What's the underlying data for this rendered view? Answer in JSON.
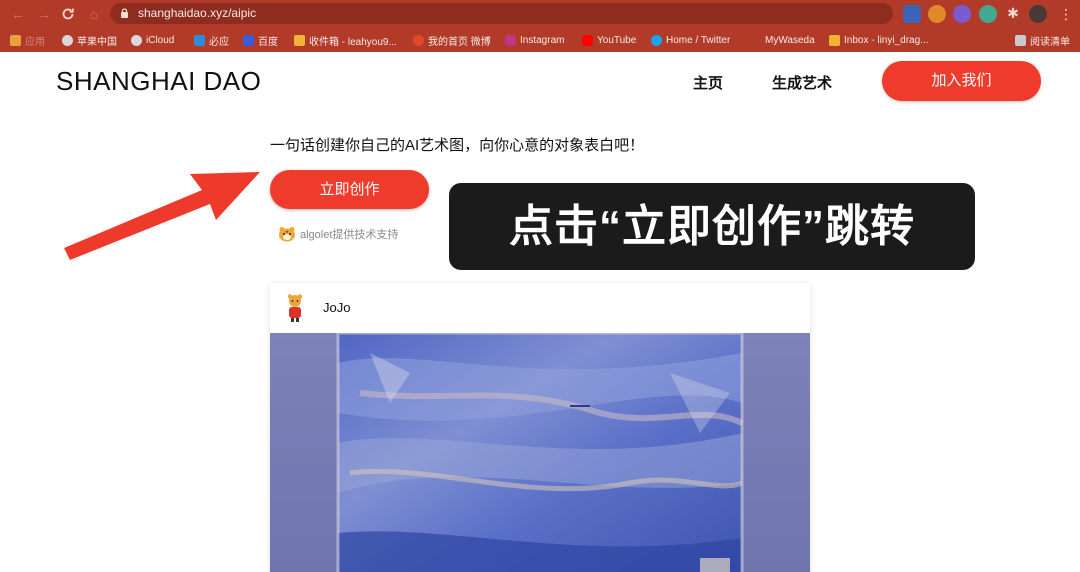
{
  "browser": {
    "url": "shanghaidao.xyz/aipic",
    "bookmarks": [
      {
        "label": "应用",
        "color": "#e9a23b"
      },
      {
        "label": "苹果中国",
        "color": "#d9d9d9"
      },
      {
        "label": "iCloud",
        "color": "#d9d9d9"
      },
      {
        "label": "必应",
        "color": "#2f8bd8"
      },
      {
        "label": "百度",
        "color": "#3b5cd6"
      },
      {
        "label": "收件箱 - leahyou9...",
        "color": "#f2b233"
      },
      {
        "label": "我的首页 微博",
        "color": "#e2492a"
      },
      {
        "label": "Instagram",
        "color": "#c13584"
      },
      {
        "label": "YouTube",
        "color": "#ff0000"
      },
      {
        "label": "Home / Twitter",
        "color": "#1da1f2"
      },
      {
        "label": "MyWaseda",
        "color": "#b13a28"
      },
      {
        "label": "Inbox - linyi_drag...",
        "color": "#f2b233"
      },
      {
        "label": "阅读清单",
        "color": "#c9c9c9"
      }
    ]
  },
  "site": {
    "logo": "SHANGHAI DAO",
    "nav": [
      "主页",
      "生成艺术"
    ],
    "join_label": "加入我们"
  },
  "hero": {
    "tagline": "一句话创建你自己的AI艺术图，向你心意的对象表白吧！",
    "create_label": "立即创作",
    "support_text": "algolet提供技术支持"
  },
  "annotation": {
    "callout_text": "点击“立即创作”跳转",
    "arrow_color": "#ee3a2a"
  },
  "card": {
    "username": "JoJo"
  },
  "colors": {
    "accent": "#ef3b2c",
    "chrome": "#b13a28",
    "callout_bg": "#1b1b1b"
  }
}
